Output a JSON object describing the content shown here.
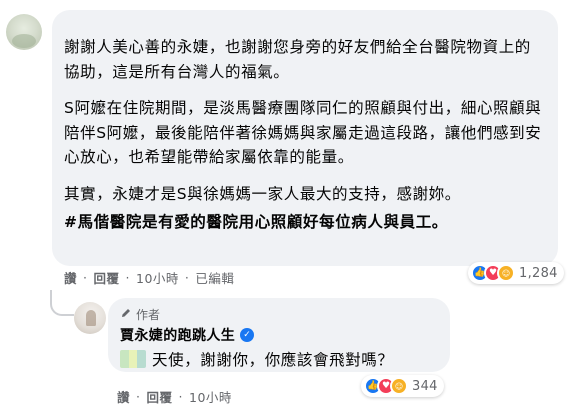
{
  "comment": {
    "paragraphs": [
      "謝謝人美心善的永婕，也謝謝您身旁的好友們給全台醫院物資上的協助，這是所有台灣人的福氣。",
      "S阿嬤在住院期間，是淡馬醫療團隊同仁的照顧與付出，細心照顧與陪伴S阿嬤，最後能陪伴著徐媽媽與家屬走過這段路，讓他們感到安心放心，也希望能帶給家屬依靠的能量。",
      "其實，永婕才是S與徐媽媽一家人最大的支持，感謝妳。"
    ],
    "hashtag": "#馬偕醫院是有愛的醫院用心照顧好每位病人與員工。",
    "actions": {
      "like": "讚",
      "reply": "回覆",
      "time": "10小時",
      "edited": "已編輯"
    },
    "reactions": {
      "count": "1,284",
      "icons": [
        "like-icon",
        "love-icon",
        "haha-icon"
      ]
    }
  },
  "reply": {
    "author_badge": "作者",
    "name": "賈永婕的跑跳人生",
    "text": "天使，謝謝你，你應該會飛對嗎？",
    "actions": {
      "like": "讚",
      "reply": "回覆",
      "time": "10小時"
    },
    "reactions": {
      "count": "344",
      "icons": [
        "like-icon",
        "love-icon",
        "haha-icon"
      ]
    }
  },
  "colors": {
    "bubble": "#f0f2f5",
    "link_blue": "#1877f2",
    "love_red": "#f33e58",
    "haha_yellow": "#f7b125",
    "meta_gray": "#65676b"
  }
}
